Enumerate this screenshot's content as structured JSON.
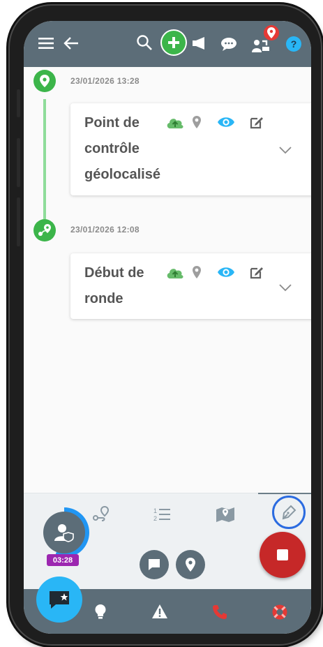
{
  "events": [
    {
      "datetime": "23/01/2026 13:28",
      "title_lines": [
        "Point de",
        "contrôle",
        "géolocalisé"
      ]
    },
    {
      "datetime": "23/01/2026 12:08",
      "title_lines": [
        "Début de",
        "ronde"
      ]
    }
  ],
  "session": {
    "timer": "03:28"
  },
  "colors": {
    "topbar": "#5c6d78",
    "green": "#3cb54a",
    "accent_cyan": "#29b6f6",
    "stop_red": "#c62828",
    "timer_purple": "#9c27b0",
    "call_red": "#e53935"
  },
  "icons": {
    "topbar": [
      "menu-icon",
      "back-arrow-icon",
      "search-icon",
      "add-icon",
      "megaphone-icon",
      "chat-icon",
      "users-location-icon",
      "help-icon"
    ],
    "card": [
      "cloud-upload-icon",
      "location-pin-icon",
      "eye-icon",
      "edit-icon",
      "chevron-down-icon"
    ],
    "tabs": [
      "route-icon",
      "numbered-list-icon",
      "map-icon",
      "pen-icon"
    ],
    "bottom": [
      "message-star-icon",
      "lightbulb-icon",
      "warning-icon",
      "phone-icon",
      "lifebuoy-icon"
    ]
  }
}
